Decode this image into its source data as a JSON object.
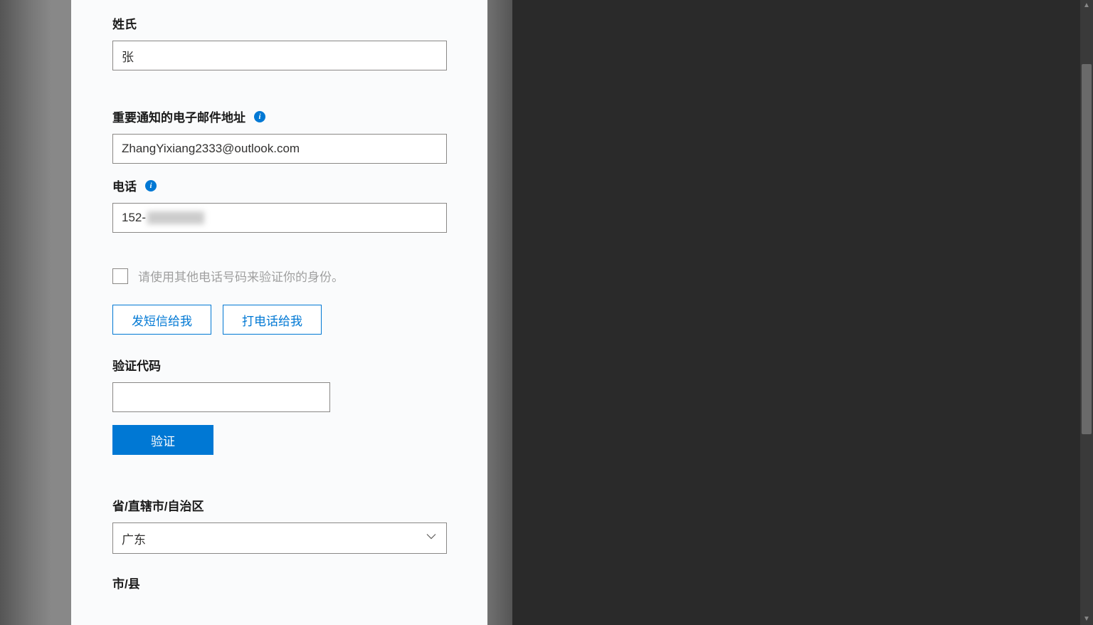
{
  "form": {
    "surname": {
      "label": "姓氏",
      "value": "张"
    },
    "email": {
      "label": "重要通知的电子邮件地址",
      "value": "ZhangYixiang2333@outlook.com"
    },
    "phone": {
      "label": "电话",
      "prefix": "152-"
    },
    "alt_phone_checkbox": {
      "label": "请使用其他电话号码来验证你的身份。"
    },
    "buttons": {
      "text_me": "发短信给我",
      "call_me": "打电话给我",
      "verify": "验证"
    },
    "verification_code": {
      "label": "验证代码",
      "value": ""
    },
    "province": {
      "label": "省/直辖市/自治区",
      "value": "广东"
    },
    "city": {
      "label": "市/县"
    }
  }
}
